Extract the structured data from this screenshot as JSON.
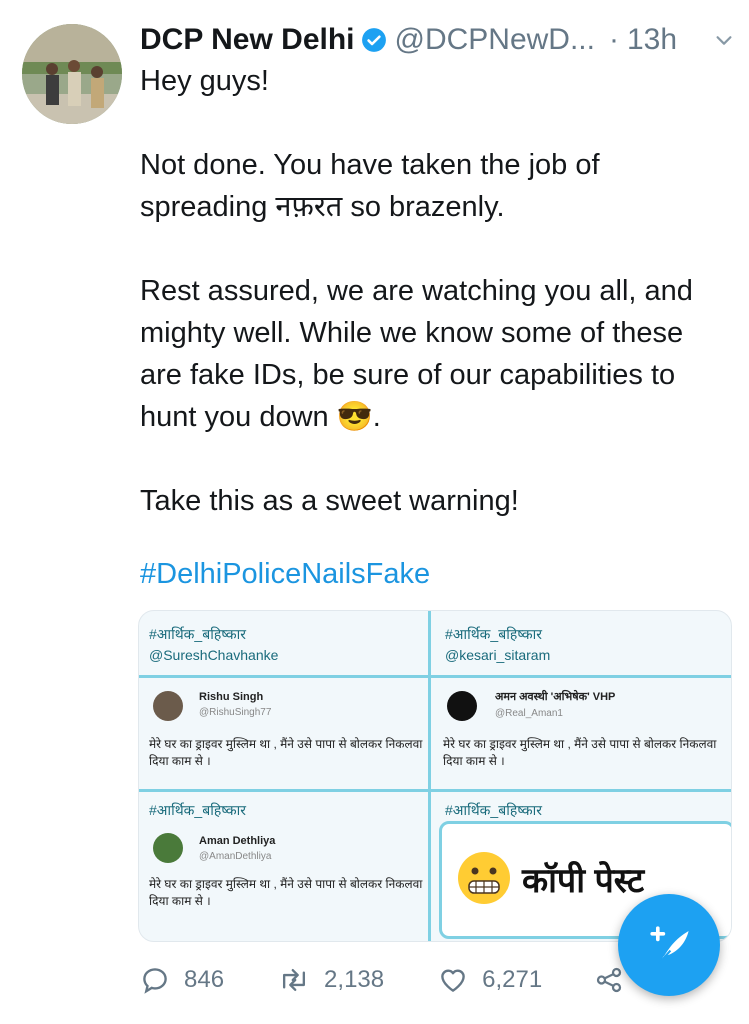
{
  "tweet": {
    "author_name": "DCP New Delhi",
    "handle": "@DCPNewD...",
    "separator": "·",
    "time": "13h",
    "paragraphs": [
      "Hey guys!",
      "Not done. You have taken the job of spreading नफ़रत so brazenly.",
      "Rest assured, we are watching you all, and mighty well. While we know some of these are fake IDs, be sure of our capabilities to hunt you down 😎.",
      "Take this as a sweet warning!"
    ],
    "hashtag": "#DelhiPoliceNailsFake"
  },
  "media": {
    "q1": {
      "tag": "#आर्थिक_बहिष्कार",
      "mention": "@SureshChavhanke"
    },
    "q2": {
      "tag": "#आर्थिक_बहिष्कार",
      "mention": "@kesari_sitaram"
    },
    "card1": {
      "name": "Rishu Singh",
      "handle": "@RishuSingh77",
      "text": "मेरे घर का ड्राइवर मुस्लिम था , मैंने उसे पापा से बोलकर निकलवा दिया काम से ।"
    },
    "card2": {
      "name": "अमन अवस्थी 'अभिषेक' VHP",
      "handle": "@Real_Aman1",
      "text": "मेरे घर का ड्राइवर मुस्लिम था , मैंने उसे पापा से बोलकर निकलवा दिया काम से ।"
    },
    "q3": {
      "tag": "#आर्थिक_बहिष्कार"
    },
    "q4": {
      "tag": "#आर्थिक_बहिष्कार"
    },
    "card3": {
      "name": "Aman Dethliya",
      "handle": "@AmanDethliya",
      "text": "मेरे घर का ड्राइवर मुस्लिम था , मैंने उसे पापा से बोलकर निकलवा दिया काम से ।"
    },
    "copy_paste": "कॉपी पेस्ट"
  },
  "actions": {
    "replies": "846",
    "retweets": "2,138",
    "likes": "6,271"
  },
  "colors": {
    "accent": "#1da1f2",
    "hashtag": "#1b95e0",
    "muted": "#657786"
  }
}
